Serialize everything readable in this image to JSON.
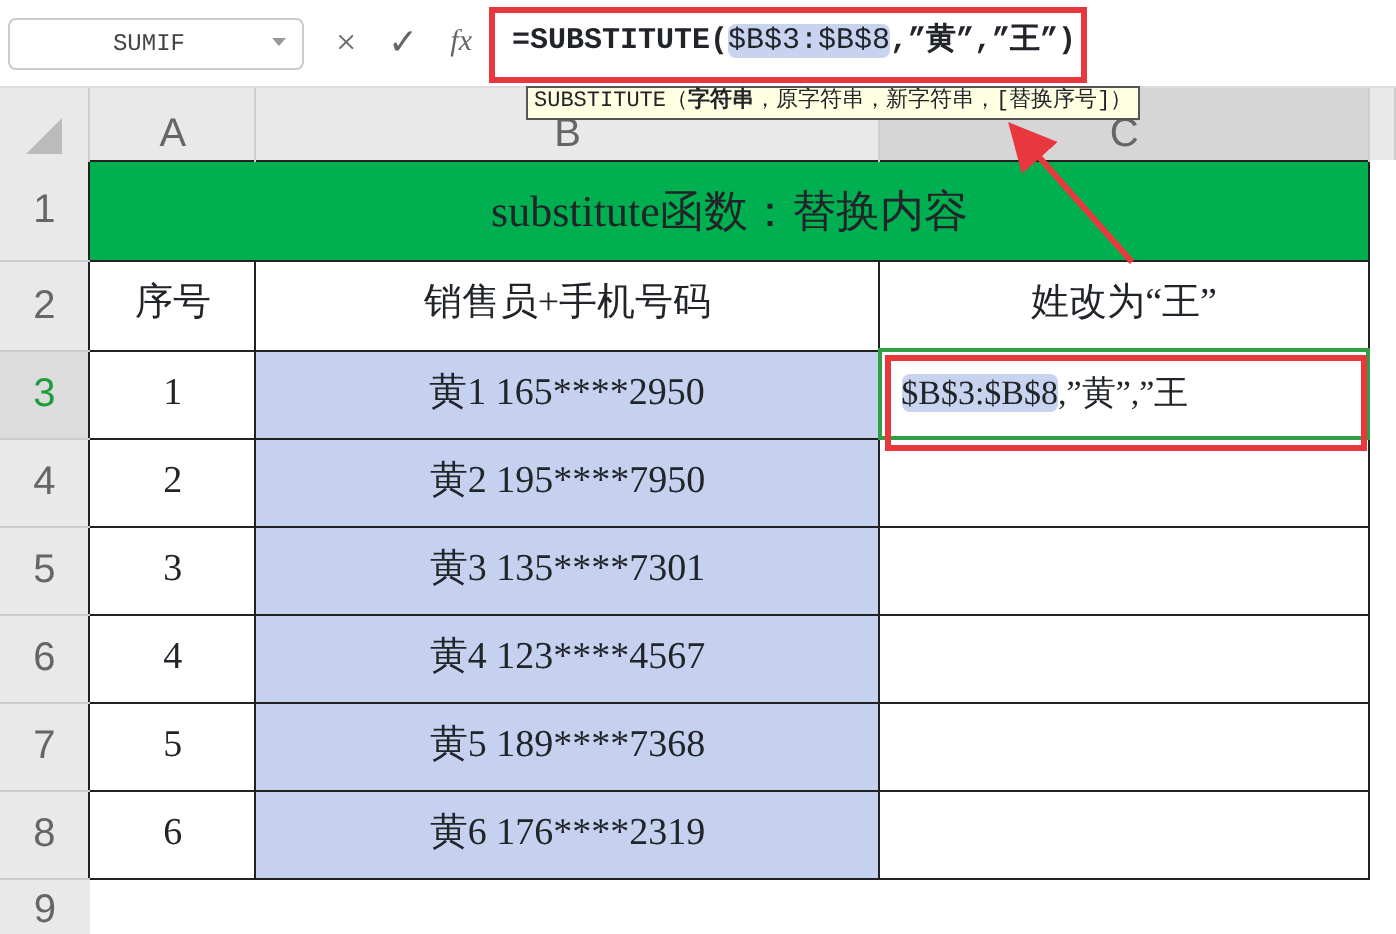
{
  "formula_bar": {
    "name_box": "SUMIF",
    "cancel": "×",
    "enter": "✓",
    "fx": "fx",
    "formula": [
      {
        "text": "=SUBSTITUTE(",
        "highlighted": false
      },
      {
        "text": "$B$3:$B$8",
        "highlighted": true
      },
      {
        "text": ",”黄”,”王”)",
        "highlighted": false
      }
    ]
  },
  "tooltip": "SUBSTITUTE（**字符串**，原字符串，新字符串，[替换序号]）",
  "column_headers": [
    {
      "label": "A",
      "selected": false
    },
    {
      "label": "B",
      "selected": false
    },
    {
      "label": "C",
      "selected": true
    }
  ],
  "title": "substitute函数：替换内容",
  "header_row": [
    "序号",
    "销售员+手机号码",
    "姓改为“王”"
  ],
  "row_headers": [
    {
      "label": "1",
      "selected": false
    },
    {
      "label": "2",
      "selected": false
    },
    {
      "label": "3",
      "selected": true
    },
    {
      "label": "4",
      "selected": false
    },
    {
      "label": "5",
      "selected": false
    },
    {
      "label": "6",
      "selected": false
    },
    {
      "label": "7",
      "selected": false
    },
    {
      "label": "8",
      "selected": false
    },
    {
      "label": "9",
      "selected": false
    }
  ],
  "rows": [
    {
      "seq": "1",
      "sales": "黄1  165****2950",
      "result": [
        {
          "text": "$B$3:$B$8",
          "highlighted": true
        },
        {
          "text": ",”黄”,”王",
          "highlighted": false
        }
      ]
    },
    {
      "seq": "2",
      "sales": "黄2  195****7950"
    },
    {
      "seq": "3",
      "sales": "黄3  135****7301"
    },
    {
      "seq": "4",
      "sales": "黄4  123****4567"
    },
    {
      "seq": "5",
      "sales": "黄5  189****7368"
    },
    {
      "seq": "6",
      "sales": "黄6  176****2319"
    }
  ]
}
